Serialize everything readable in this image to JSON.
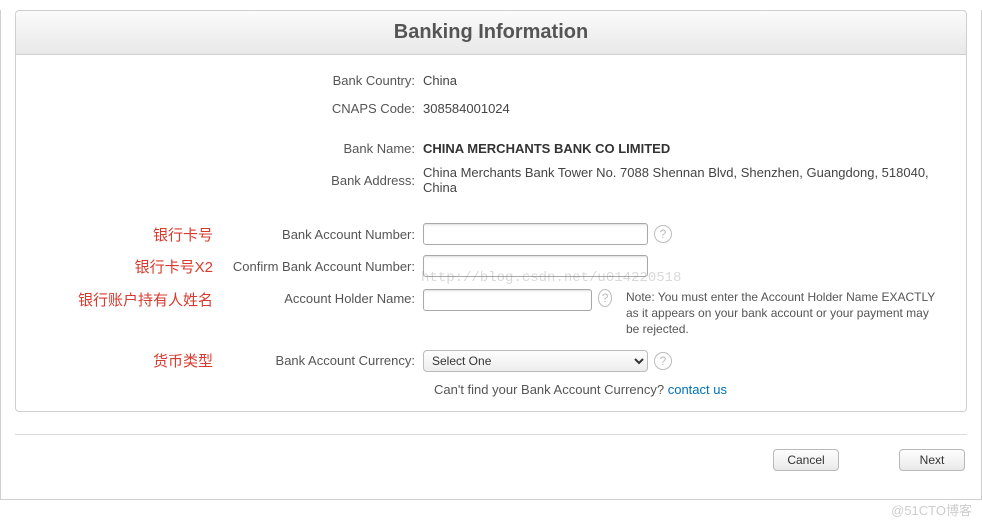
{
  "header": {
    "title": "Banking Information"
  },
  "info": {
    "bank_country_label": "Bank Country:",
    "bank_country_value": "China",
    "cnaps_label": "CNAPS Code:",
    "cnaps_value": "308584001024",
    "bank_name_label": "Bank Name:",
    "bank_name_value": "CHINA MERCHANTS BANK CO LIMITED",
    "bank_address_label": "Bank Address:",
    "bank_address_value": "China Merchants Bank Tower No. 7088 Shennan Blvd, Shenzhen, Guangdong, 518040, China"
  },
  "annotations": {
    "account_number": "银行卡号",
    "confirm_number": "银行卡号X2",
    "holder_name": "银行账户持有人姓名",
    "currency": "货币类型"
  },
  "fields": {
    "account_number_label": "Bank Account Number:",
    "confirm_number_label": "Confirm Bank Account Number:",
    "holder_name_label": "Account Holder Name:",
    "currency_label": "Bank Account Currency:",
    "currency_selected": "Select One",
    "holder_note": "Note: You must enter the Account Holder Name EXACTLY as it appears on your bank account or your payment may be rejected."
  },
  "hint": {
    "text": "Can't find your Bank Account Currency?  ",
    "link": "contact us"
  },
  "buttons": {
    "cancel": "Cancel",
    "next": "Next"
  },
  "watermarks": {
    "center": "http://blog.csdn.net/u014220518",
    "corner": "@51CTO博客"
  },
  "help_glyph": "?"
}
